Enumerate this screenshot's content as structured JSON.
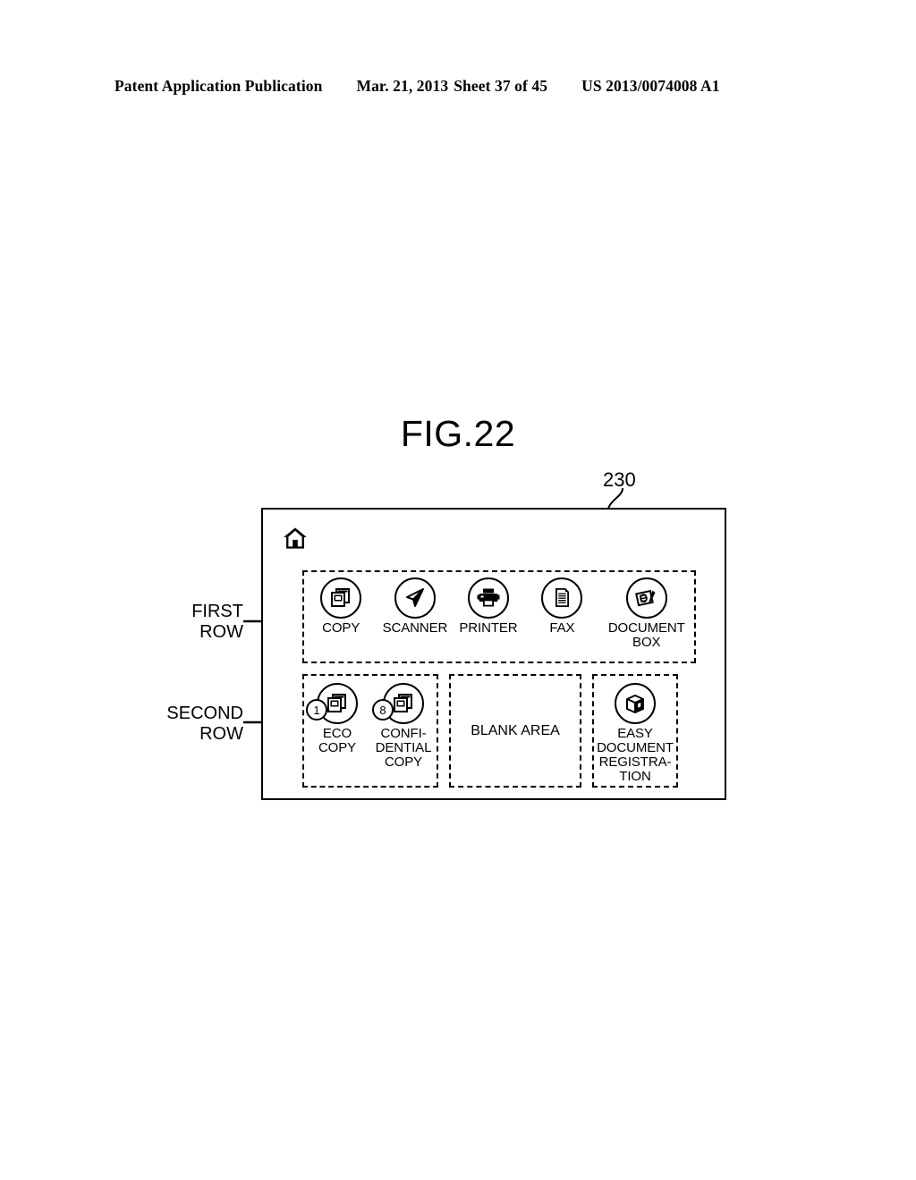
{
  "header": {
    "publication": "Patent Application Publication",
    "date": "Mar. 21, 2013",
    "sheet": "Sheet 37 of 45",
    "patent_number": "US 2013/0074008 A1"
  },
  "figure": {
    "title": "FIG.22",
    "reference_numeral": "230"
  },
  "callouts": {
    "first_row": "FIRST\nROW",
    "second_row": "SECOND\nROW"
  },
  "panel": {
    "home_icon": "home-icon",
    "first_row": {
      "items": [
        {
          "label": "COPY",
          "icon": "copy-icon"
        },
        {
          "label": "SCANNER",
          "icon": "scanner-icon"
        },
        {
          "label": "PRINTER",
          "icon": "printer-icon"
        },
        {
          "label": "FAX",
          "icon": "fax-icon"
        },
        {
          "label": "DOCUMENT\nBOX",
          "icon": "document-box-icon"
        }
      ]
    },
    "second_row": {
      "shortcuts": [
        {
          "label": "ECO\nCOPY",
          "icon": "copy-icon",
          "badge": "1"
        },
        {
          "label": "CONFI-\nDENTIAL\nCOPY",
          "icon": "copy-icon",
          "badge": "8"
        }
      ],
      "blank_area_label": "BLANK AREA",
      "registration": {
        "label": "EASY\nDOCUMENT\nREGISTRA-\nTION",
        "icon": "box-3d-icon"
      }
    }
  }
}
